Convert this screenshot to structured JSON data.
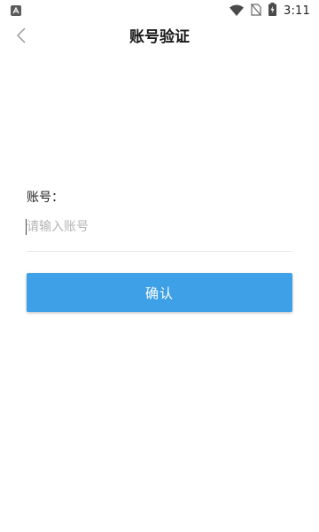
{
  "status_bar": {
    "time": "3:11",
    "icons": [
      "notification-app-icon",
      "wifi-icon",
      "no-sim-icon",
      "battery-charging-icon"
    ]
  },
  "header": {
    "title": "账号验证",
    "back_icon": "chevron-left-icon"
  },
  "form": {
    "account_label": "账号：",
    "account_placeholder": "请输入账号",
    "account_value": ""
  },
  "actions": {
    "confirm_label": "确认"
  },
  "colors": {
    "primary_button": "#3ea0e6",
    "background": "#ffffff",
    "placeholder": "#b4b4b4"
  }
}
